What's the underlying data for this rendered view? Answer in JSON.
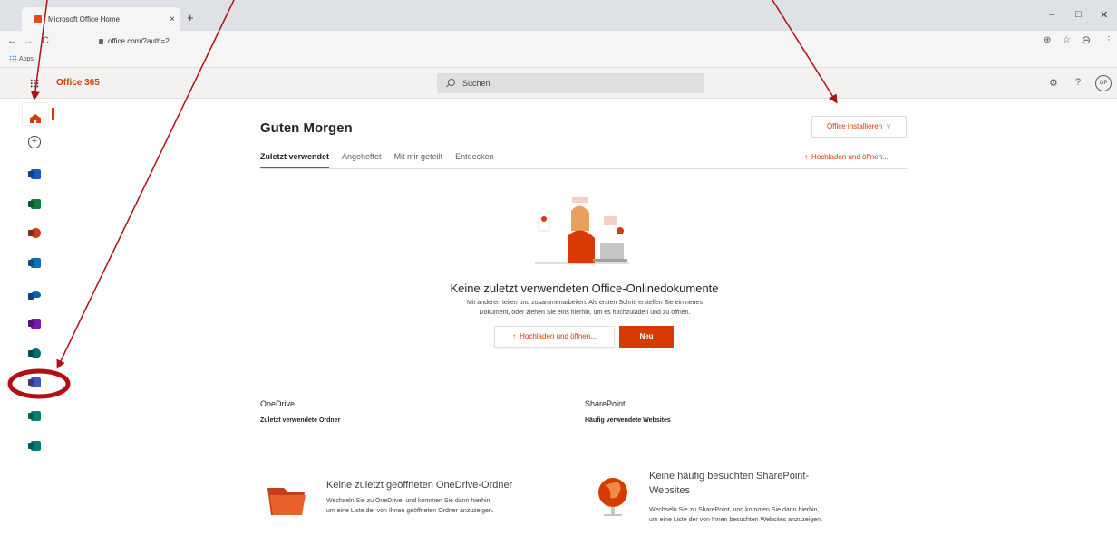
{
  "browser": {
    "tab_title": "Microsoft Office Home",
    "tab_close": "×",
    "new_tab": "+",
    "url": "office.com/?auth=2",
    "bookmarks_apps": "Apps",
    "back": "←",
    "forward": "→",
    "reload": "C",
    "minimize": "–",
    "maximize": "□",
    "close": "✕",
    "star": "☆",
    "add": "⊕",
    "profile": "⊖",
    "menu": "⋮"
  },
  "o365": {
    "brand": "Office 365",
    "search_placeholder": "Suchen",
    "settings_icon": "⚙",
    "help": "?",
    "avatar": "GP"
  },
  "rail": {
    "items": [
      {
        "name": "home",
        "color": "#d83b01"
      },
      {
        "name": "create",
        "color": "#444444"
      },
      {
        "name": "word",
        "color": "#185abd"
      },
      {
        "name": "excel",
        "color": "#107c41"
      },
      {
        "name": "powerpoint",
        "color": "#c43e1c"
      },
      {
        "name": "outlook",
        "color": "#0f6cbd"
      },
      {
        "name": "onedrive",
        "color": "#0364b8"
      },
      {
        "name": "onenote",
        "color": "#7719aa"
      },
      {
        "name": "sharepoint",
        "color": "#036c70"
      },
      {
        "name": "teams",
        "color": "#4b53bc"
      },
      {
        "name": "sway",
        "color": "#008272"
      },
      {
        "name": "forms",
        "color": "#007c7c"
      }
    ]
  },
  "main": {
    "greeting": "Guten Morgen",
    "install": "Office installieren",
    "install_chevron": "∨",
    "tabs": [
      "Zuletzt verwendet",
      "Angeheftet",
      "Mit mir geteilt",
      "Entdecken"
    ],
    "upload_open": "Hochladen und öffnen...",
    "upload_icon": "↑",
    "empty_title": "Keine zuletzt verwendeten Office-Onlinedokumente",
    "empty_desc_1": "Mit anderen teilen und zusammenarbeiten. Als ersten Schritt erstellen Sie ein neues",
    "empty_desc_2": "Dokument, oder ziehen Sie eins hierhin, um es hochzuladen und zu öffnen.",
    "new_button": "Neu"
  },
  "onedrive": {
    "title": "OneDrive",
    "subtitle": "Zuletzt verwendete Ordner",
    "empty_title": "Keine zuletzt geöffneten OneDrive-Ordner",
    "empty_text_1": "Wechseln Sie zu OneDrive, und kommen Sie dann hierhin,",
    "empty_text_2": "um eine Liste der von Ihnen geöffneten Ordner anzuzeigen."
  },
  "sharepoint": {
    "title": "SharePoint",
    "subtitle": "Häufig verwendete Websites",
    "empty_title_1": "Keine häufig besuchten SharePoint-",
    "empty_title_2": "Websites",
    "empty_text_1": "Wechseln Sie zu SharePoint, und kommen Sie dann hierhin,",
    "empty_text_2": "um eine Liste der von Ihnen besuchten Websites anzuzeigen."
  },
  "annotation_color": "#b01014"
}
